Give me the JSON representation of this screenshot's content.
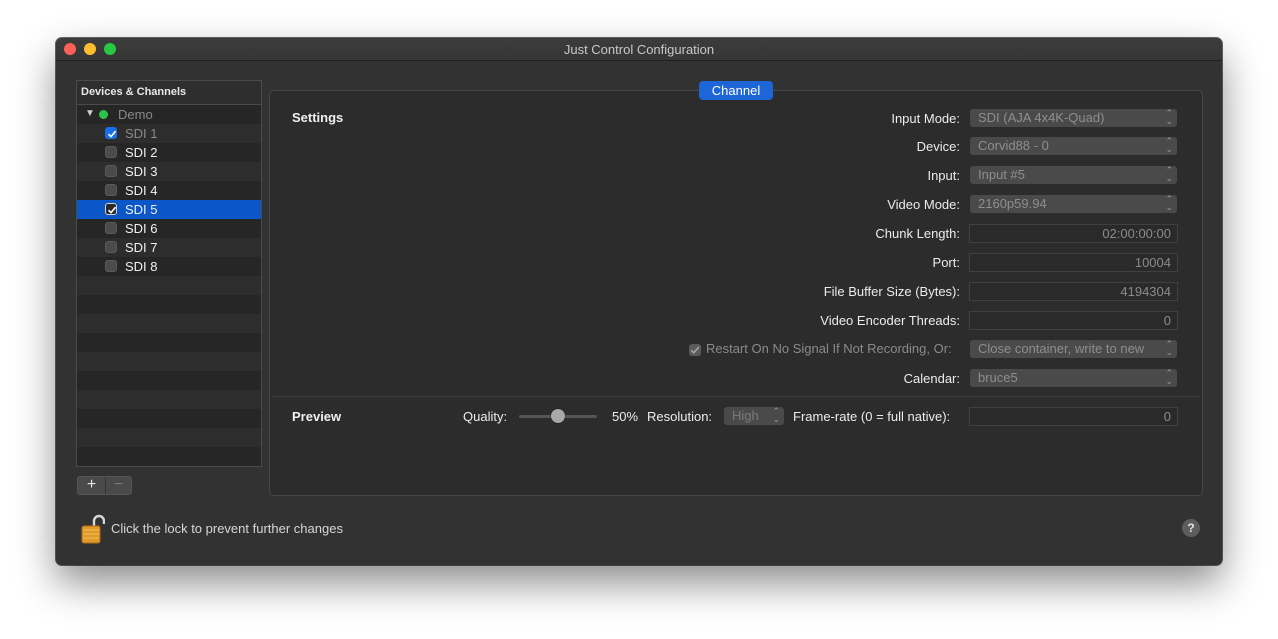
{
  "window": {
    "title": "Just Control Configuration"
  },
  "sidebar": {
    "header": "Devices & Channels",
    "group": {
      "label": "Demo"
    },
    "channels": [
      {
        "label": "SDI 1",
        "checked": true,
        "selected": false,
        "dimmed": true
      },
      {
        "label": "SDI 2",
        "checked": false,
        "selected": false,
        "dimmed": false
      },
      {
        "label": "SDI 3",
        "checked": false,
        "selected": false,
        "dimmed": false
      },
      {
        "label": "SDI 4",
        "checked": false,
        "selected": false,
        "dimmed": false
      },
      {
        "label": "SDI 5",
        "checked": true,
        "selected": true,
        "dimmed": false
      },
      {
        "label": "SDI 6",
        "checked": false,
        "selected": false,
        "dimmed": false
      },
      {
        "label": "SDI 7",
        "checked": false,
        "selected": false,
        "dimmed": false
      },
      {
        "label": "SDI 8",
        "checked": false,
        "selected": false,
        "dimmed": false
      }
    ],
    "add_label": "+",
    "remove_label": "−"
  },
  "tab": {
    "label": "Channel"
  },
  "settings": {
    "title": "Settings",
    "input_mode": {
      "label": "Input Mode:",
      "value": "SDI (AJA 4x4K-Quad)"
    },
    "device": {
      "label": "Device:",
      "value": "Corvid88 - 0"
    },
    "input": {
      "label": "Input:",
      "value": "Input #5"
    },
    "video_mode": {
      "label": "Video Mode:",
      "value": "2160p59.94"
    },
    "chunk_length": {
      "label": "Chunk Length:",
      "value": "02:00:00:00"
    },
    "port": {
      "label": "Port:",
      "value": "10004"
    },
    "file_buffer": {
      "label": "File Buffer Size (Bytes):",
      "value": "4194304"
    },
    "encoder_threads": {
      "label": "Video Encoder Threads:",
      "value": "0"
    },
    "restart": {
      "label": "Restart On No Signal If Not Recording, Or:",
      "checked": true,
      "value": "Close container, write to new"
    },
    "calendar": {
      "label": "Calendar:",
      "value": "bruce5"
    }
  },
  "preview": {
    "title": "Preview",
    "quality_label": "Quality:",
    "quality_value": "50%",
    "quality_fraction": 0.5,
    "resolution_label": "Resolution:",
    "resolution_value": "High",
    "framerate_label": "Frame-rate (0 = full native):",
    "framerate_value": "0"
  },
  "footer": {
    "lock_text": "Click the lock to prevent further changes",
    "help_label": "?"
  },
  "colors": {
    "accent": "#1e66d8",
    "selection": "#0b56c8",
    "status_green": "#2fc24a"
  }
}
